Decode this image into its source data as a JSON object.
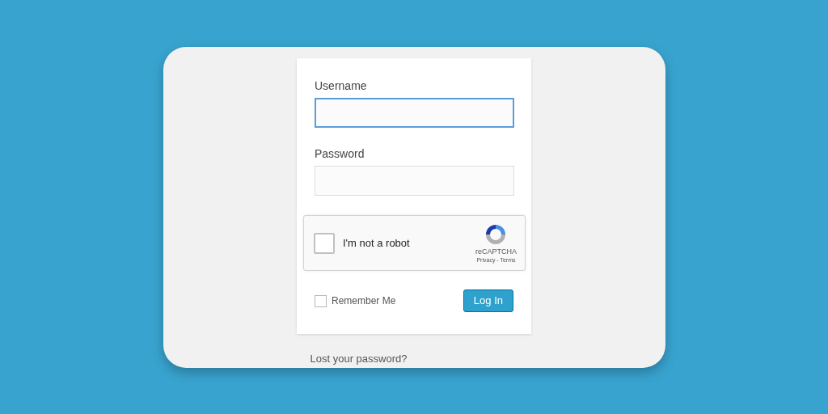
{
  "form": {
    "fields": [
      {
        "label": "Username",
        "focused": true
      },
      {
        "label": "Password",
        "focused": false
      }
    ],
    "captcha": {
      "label": "I'm not a robot",
      "checked": false,
      "brand": "reCAPTCHA",
      "links": "Privacy - Terms"
    },
    "remember": {
      "label": "Remember Me",
      "checked": false
    },
    "submit": "Log In"
  },
  "lost_password": "Lost your password?"
}
